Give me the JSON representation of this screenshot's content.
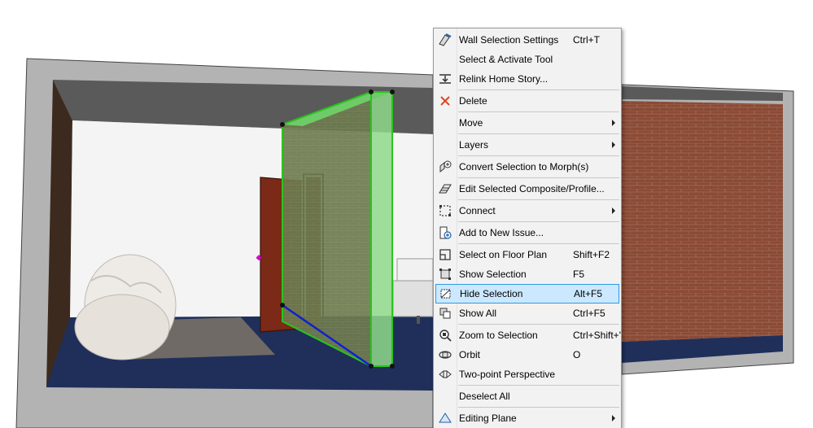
{
  "context_menu": {
    "items": [
      {
        "label": "Wall Selection Settings",
        "shortcut": "Ctrl+T",
        "icon": "wall-settings-icon"
      },
      {
        "label": "Select & Activate Tool",
        "shortcut": "",
        "icon": ""
      },
      {
        "label": "Relink Home Story...",
        "shortcut": "",
        "icon": "relink-story-icon"
      },
      {
        "label": "Delete",
        "shortcut": "",
        "icon": "delete-x-icon"
      },
      {
        "label": "Move",
        "shortcut": "",
        "icon": ""
      },
      {
        "label": "Layers",
        "shortcut": "",
        "icon": ""
      },
      {
        "label": "Convert Selection to Morph(s)",
        "shortcut": "",
        "icon": "morph-icon"
      },
      {
        "label": "Edit Selected Composite/Profile...",
        "shortcut": "",
        "icon": "composite-icon"
      },
      {
        "label": "Connect",
        "shortcut": "",
        "icon": "connect-icon"
      },
      {
        "label": "Add to New Issue...",
        "shortcut": "",
        "icon": "issue-icon"
      },
      {
        "label": "Select on Floor Plan",
        "shortcut": "Shift+F2",
        "icon": "floor-plan-icon"
      },
      {
        "label": "Show Selection",
        "shortcut": "F5",
        "icon": "show-selection-icon"
      },
      {
        "label": "Hide Selection",
        "shortcut": "Alt+F5",
        "icon": "hide-selection-icon"
      },
      {
        "label": "Show All",
        "shortcut": "Ctrl+F5",
        "icon": "show-all-icon"
      },
      {
        "label": "Zoom to Selection",
        "shortcut": "Ctrl+Shift+'",
        "icon": "zoom-selection-icon"
      },
      {
        "label": "Orbit",
        "shortcut": "O",
        "icon": "orbit-icon"
      },
      {
        "label": "Two-point Perspective",
        "shortcut": "",
        "icon": "perspective-icon"
      },
      {
        "label": "Deselect All",
        "shortcut": "",
        "icon": ""
      },
      {
        "label": "Editing Plane",
        "shortcut": "",
        "icon": "editing-plane-icon"
      }
    ]
  },
  "colors": {
    "selection_green": "#29c41e",
    "brick": "#8a4a36",
    "floor": "#1f2f5a",
    "menu_highlight": "#cce8ff"
  }
}
